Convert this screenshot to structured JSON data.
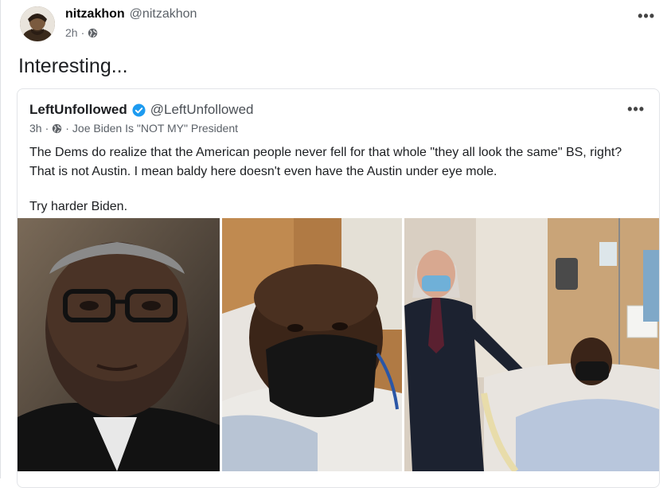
{
  "post": {
    "author_name": "nitzakhon",
    "author_handle": "@nitzakhon",
    "time": "2h",
    "separator": "·",
    "more": "•••",
    "text": "Interesting..."
  },
  "quote": {
    "author_name": "LeftUnfollowed",
    "author_handle": "@LeftUnfollowed",
    "time": "3h",
    "separator": "·",
    "group": "Joe Biden Is \"NOT MY\" President",
    "more": "•••",
    "paragraph1": "The Dems do realize that the American people never fell for that whole \"they all look the same\" BS, right? That is not Austin. I mean baldy here doesn't even have the Austin under eye mole.",
    "paragraph2": "Try harder Biden."
  },
  "photos": [
    {
      "subject": "portrait-man-glasses"
    },
    {
      "subject": "patient-mask-closeup"
    },
    {
      "subject": "hospital-visit"
    }
  ],
  "icons": {
    "globe": "globe-icon",
    "verified": "verified-badge-icon",
    "more": "more-icon"
  },
  "colors": {
    "verified": "#1d9bf0",
    "mask": "#151515",
    "bed": "#e8e4df"
  }
}
